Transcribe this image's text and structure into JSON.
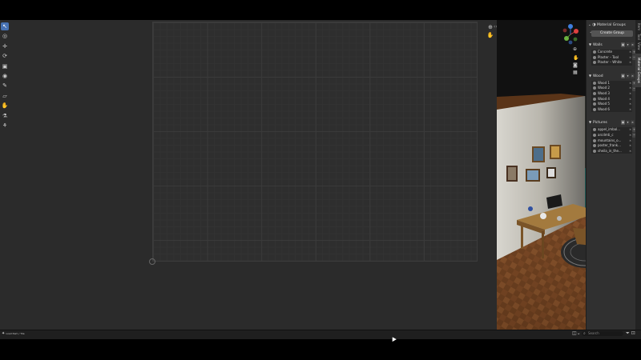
{
  "toolbar": {
    "tools": [
      {
        "icon": "select-cursor-icon",
        "glyph": "↖",
        "active": true
      },
      {
        "icon": "cursor-3d-icon",
        "glyph": "◎",
        "active": false
      },
      {
        "icon": "move-icon",
        "glyph": "✛",
        "active": false
      },
      {
        "icon": "rotate-icon",
        "glyph": "⟳",
        "active": false
      },
      {
        "icon": "scale-icon",
        "glyph": "▣",
        "active": false
      },
      {
        "icon": "transform-icon",
        "glyph": "◉",
        "active": false
      },
      {
        "icon": "annotate-icon",
        "glyph": "✎",
        "active": false
      },
      {
        "icon": "rip-icon",
        "glyph": "▱",
        "active": false
      },
      {
        "icon": "grab-icon",
        "glyph": "✋",
        "active": false
      },
      {
        "icon": "relax-icon",
        "glyph": "⚗",
        "active": false
      },
      {
        "icon": "pinch-icon",
        "glyph": "⚘",
        "active": false
      }
    ]
  },
  "sidebar": {
    "panel_title": "Material Groups",
    "create_label": "Create Group",
    "groups": [
      {
        "name": "Walls",
        "materials": [
          "Concrete",
          "Plaster – Tool",
          "Plaster – White"
        ]
      },
      {
        "name": "Wood",
        "materials": [
          "Wood 1",
          "Wood 2",
          "Wood 3",
          "Wood 4",
          "Wood 5",
          "Wood 6"
        ]
      },
      {
        "name": "Pictures",
        "materials": [
          "appel_imbal...",
          "arcdmti_c",
          "mountains_o...",
          "poster_frank...",
          "sheila_in_the..."
        ]
      }
    ],
    "tabs": [
      "Item",
      "Tool",
      "View",
      "Material Groups"
    ]
  },
  "statusbar": {
    "left_text": "Load Item / Tile",
    "search_placeholder": "Search"
  },
  "colors": {
    "accent": "#4772b3",
    "editor_bg": "#2b2b2b",
    "panel_bg": "#303030",
    "viewport_bg": "#121212",
    "gizmo_x": "#e04040",
    "gizmo_y": "#6cb33f",
    "gizmo_z": "#3f7fe0"
  }
}
